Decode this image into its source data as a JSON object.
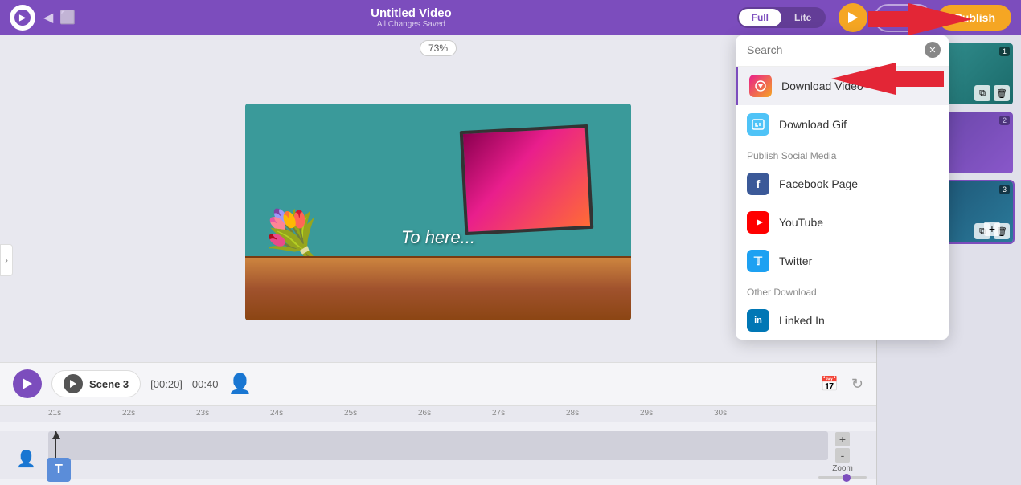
{
  "header": {
    "title": "Untitled Video",
    "subtitle": "All Changes Saved",
    "mode_full": "Full",
    "mode_lite": "Lite",
    "share_label": "Share",
    "publish_label": "Publish"
  },
  "canvas": {
    "zoom": "73%",
    "video_text": "To here..."
  },
  "bottom_controls": {
    "scene_label": "Scene 3",
    "time_current": "[00:20]",
    "time_total": "00:40"
  },
  "publish_dropdown": {
    "search_placeholder": "Search",
    "download_video_label": "Download Video",
    "download_gif_label": "Download Gif",
    "section_social": "Publish Social Media",
    "facebook_label": "Facebook Page",
    "youtube_label": "YouTube",
    "twitter_label": "Twitter",
    "section_other": "Other Download",
    "linkedin_label": "Linked In"
  },
  "timeline": {
    "zoom_label": "Zoom",
    "markers": [
      "21s",
      "22s",
      "23s",
      "24s",
      "25s",
      "26s",
      "27s",
      "28s",
      "29s",
      "30s"
    ]
  },
  "scenes": [
    {
      "num": "1"
    },
    {
      "num": "2"
    },
    {
      "num": "3"
    }
  ]
}
